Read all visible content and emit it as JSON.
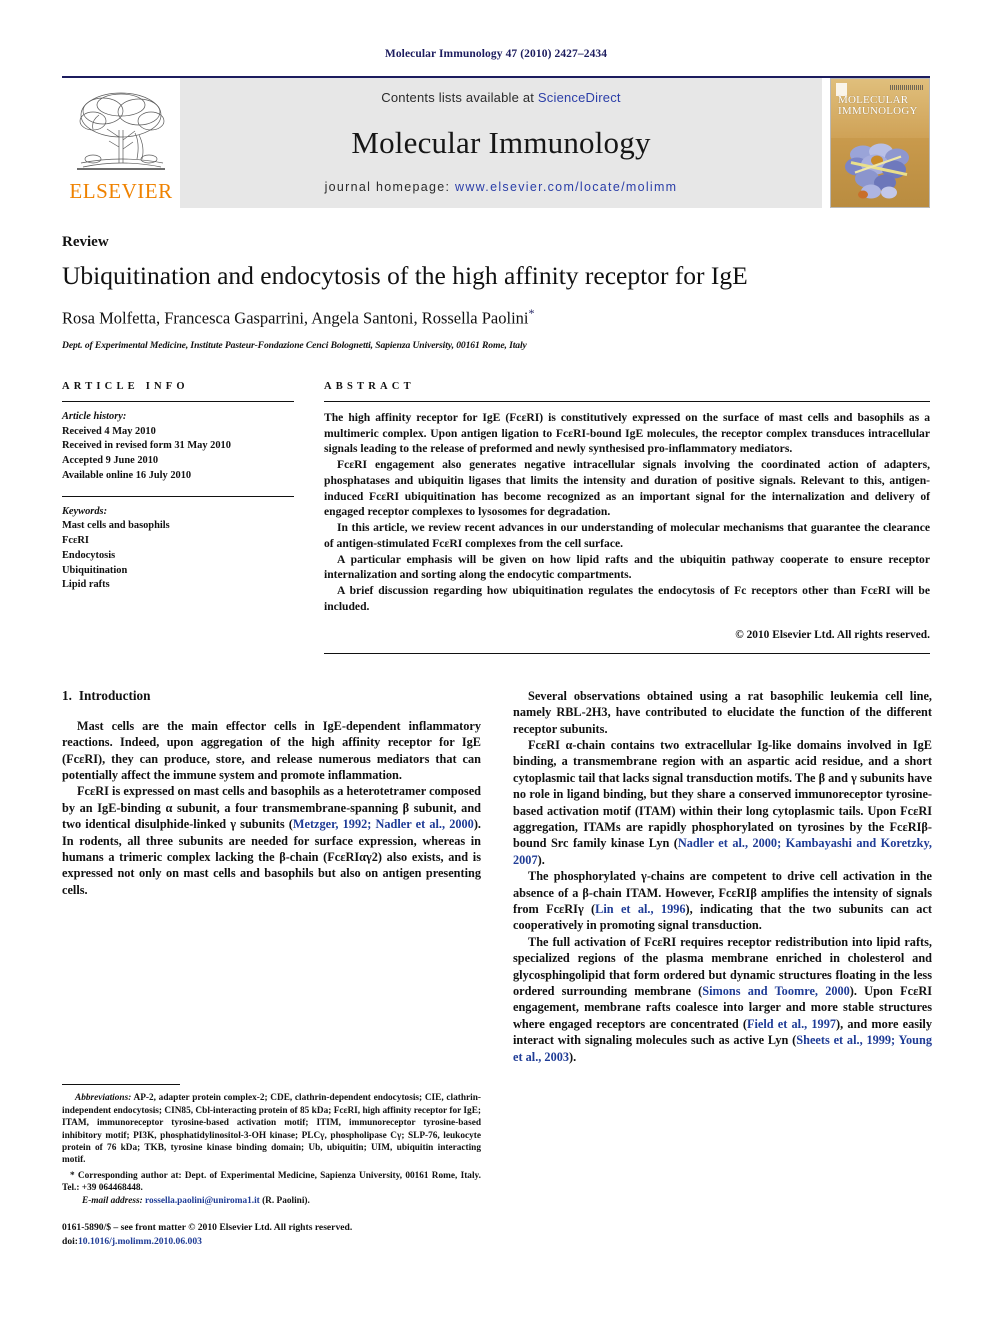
{
  "running_head": "Molecular Immunology 47 (2010) 2427–2434",
  "masthead": {
    "elsevier_wordmark": "ELSEVIER",
    "contents_prefix": "Contents lists available at ",
    "contents_link": "ScienceDirect",
    "journal_name": "Molecular Immunology",
    "homepage_prefix": "journal homepage: ",
    "homepage_url": "www.elsevier.com/locate/molimm",
    "cover_title_line1": "MOLECULAR",
    "cover_title_line2": "IMMUNOLOGY"
  },
  "article": {
    "doctype": "Review",
    "title": "Ubiquitination and endocytosis of the high affinity receptor for IgE",
    "authors": "Rosa Molfetta, Francesca Gasparrini, Angela Santoni, Rossella Paolini",
    "corresponding_marker": "*",
    "affiliation": "Dept. of Experimental Medicine, Institute Pasteur-Fondazione Cenci Bolognetti, Sapienza University, 00161 Rome, Italy"
  },
  "article_info": {
    "heading": "ARTICLE INFO",
    "history_label": "Article history:",
    "history": [
      "Received 4 May 2010",
      "Received in revised form 31 May 2010",
      "Accepted 9 June 2010",
      "Available online 16 July 2010"
    ],
    "keywords_label": "Keywords:",
    "keywords": [
      "Mast cells and basophils",
      "FcεRI",
      "Endocytosis",
      "Ubiquitination",
      "Lipid rafts"
    ]
  },
  "abstract": {
    "heading": "ABSTRACT",
    "paragraphs": [
      "The high affinity receptor for IgE (FcεRI) is constitutively expressed on the surface of mast cells and basophils as a multimeric complex. Upon antigen ligation to FcεRI-bound IgE molecules, the receptor complex transduces intracellular signals leading to the release of preformed and newly synthesised pro-inflammatory mediators.",
      "FcεRI engagement also generates negative intracellular signals involving the coordinated action of adapters, phosphatases and ubiquitin ligases that limits the intensity and duration of positive signals. Relevant to this, antigen-induced FcεRI ubiquitination has become recognized as an important signal for the internalization and delivery of engaged receptor complexes to lysosomes for degradation.",
      "In this article, we review recent advances in our understanding of molecular mechanisms that guarantee the clearance of antigen-stimulated FcεRI complexes from the cell surface.",
      "A particular emphasis will be given on how lipid rafts and the ubiquitin pathway cooperate to ensure receptor internalization and sorting along the endocytic compartments.",
      "A brief discussion regarding how ubiquitination regulates the endocytosis of Fc receptors other than FcεRI will be included."
    ],
    "copyright": "© 2010 Elsevier Ltd. All rights reserved."
  },
  "body": {
    "section_number": "1.",
    "section_title": "Introduction",
    "left_paragraphs": [
      "Mast cells are the main effector cells in IgE-dependent inflammatory reactions. Indeed, upon aggregation of the high affinity receptor for IgE (FcεRI), they can produce, store, and release numerous mediators that can potentially affect the immune system and promote inflammation.",
      "FcεRI is expressed on mast cells and basophils as a heterotetramer composed by an IgE-binding α subunit, a four transmembrane-spanning β subunit, and two identical disulphide-linked γ subunits (Metzger, 1992; Nadler et al., 2000). In rodents, all three subunits are needed for surface expression, whereas in humans a trimeric complex lacking the β-chain (FcεRIαγ2) also exists, and is expressed not only on mast cells and basophils but also on antigen presenting cells."
    ],
    "left_citations": [
      "Metzger, 1992; Nadler et al., 2000"
    ],
    "right_paragraphs": [
      "Several observations obtained using a rat basophilic leukemia cell line, namely RBL-2H3, have contributed to elucidate the function of the different receptor subunits.",
      "FcεRI α-chain contains two extracellular Ig-like domains involved in IgE binding, a transmembrane region with an aspartic acid residue, and a short cytoplasmic tail that lacks signal transduction motifs. The β and γ subunits have no role in ligand binding, but they share a conserved immunoreceptor tyrosine-based activation motif (ITAM) within their long cytoplasmic tails. Upon FcεRI aggregation, ITAMs are rapidly phosphorylated on tyrosines by the FcεRIβ-bound Src family kinase Lyn (Nadler et al., 2000; Kambayashi and Koretzky, 2007).",
      "The phosphorylated γ-chains are competent to drive cell activation in the absence of a β-chain ITAM. However, FcεRIβ amplifies the intensity of signals from FcεRIγ (Lin et al., 1996), indicating that the two subunits can act cooperatively in promoting signal transduction.",
      "The full activation of FcεRI requires receptor redistribution into lipid rafts, specialized regions of the plasma membrane enriched in cholesterol and glycosphingolipid that form ordered but dynamic structures floating in the less ordered surrounding membrane (Simons and Toomre, 2000). Upon FcεRI engagement, membrane rafts coalesce into larger and more stable structures where engaged receptors are concentrated (Field et al., 1997), and more easily interact with signaling molecules such as active Lyn (Sheets et al., 1999; Young et al., 2003)."
    ]
  },
  "footnotes": {
    "abbreviations_label": "Abbreviations:",
    "abbreviations_text": " AP-2, adapter protein complex-2; CDE, clathrin-dependent endocytosis; CIE, clathrin-independent endocytosis; CIN85, Cbl-interacting protein of 85 kDa; FcεRI, high affinity receptor for IgE; ITAM, immunoreceptor tyrosine-based activation motif; ITIM, immunoreceptor tyrosine-based inhibitory motif; PI3K, phosphatidylinositol-3-OH kinase; PLCγ, phospholipase Cγ; SLP-76, leukocyte protein of 76 kDa; TKB, tyrosine kinase binding domain; Ub, ubiquitin; UIM, ubiquitin interacting motif.",
    "corresponding_marker": "*",
    "corresponding_text": " Corresponding author at: Dept. of Experimental Medicine, Sapienza University, 00161 Rome, Italy. Tel.: +39 064468448.",
    "email_label": "E-mail address:",
    "email_address": "rossella.paolini@uniroma1.it",
    "email_suffix": " (R. Paolini).",
    "issn_line": "0161-5890/$ – see front matter © 2010 Elsevier Ltd. All rights reserved.",
    "doi_label": "doi:",
    "doi_value": "10.1016/j.molimm.2010.06.003"
  },
  "colors": {
    "navy": "#1c1c5e",
    "link_blue": "#2b3ea8",
    "citation_blue": "#1f3c96",
    "elsevier_orange": "#ef8200",
    "banner_gray": "#e7e7e7"
  }
}
